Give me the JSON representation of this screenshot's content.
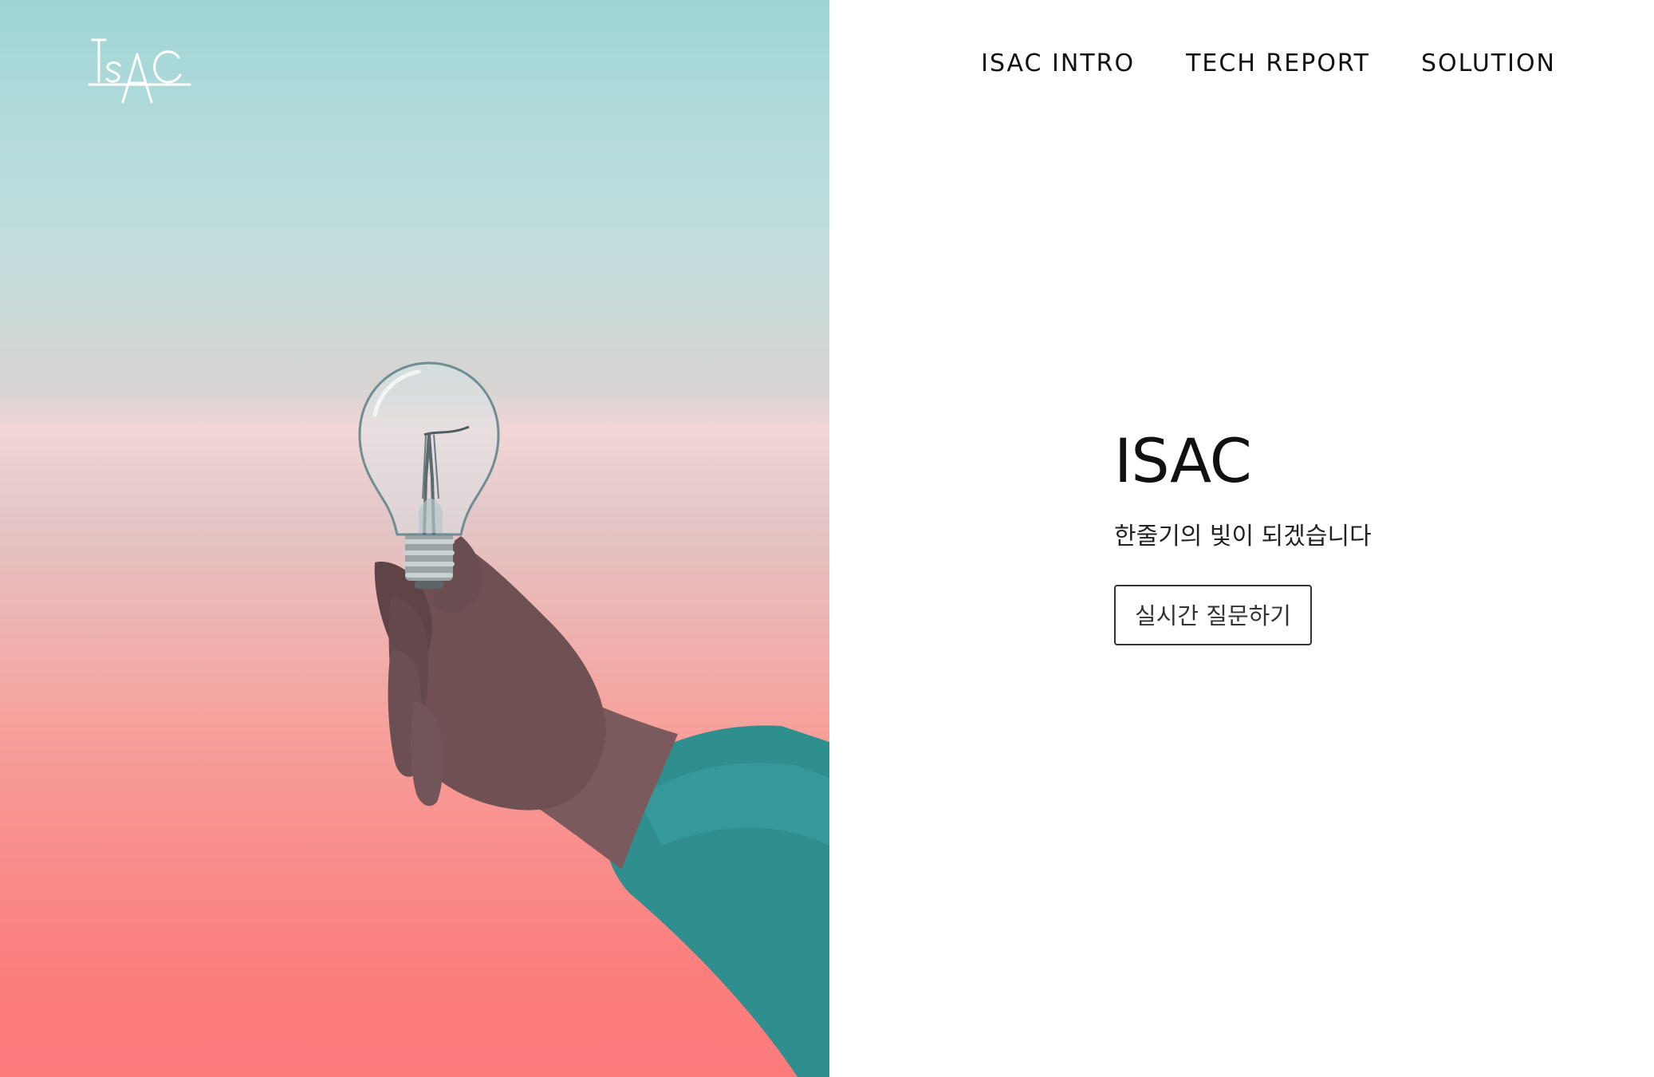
{
  "brand": {
    "logo_text": "ISAC"
  },
  "nav": {
    "items": [
      {
        "label": "ISAC INTRO"
      },
      {
        "label": "TECH REPORT"
      },
      {
        "label": "SOLUTION"
      }
    ]
  },
  "hero": {
    "image_icon": "lightbulb-in-hand-photo",
    "title": "ISAC",
    "subtitle": "한줄기의 빛이 되겠습니다",
    "cta_label": "실시간 질문하기"
  },
  "colors": {
    "sky_top": "#9fd5d6",
    "sky_bottom": "#fd7a7b",
    "sleeve": "#2f8f8f",
    "text": "#111111"
  }
}
